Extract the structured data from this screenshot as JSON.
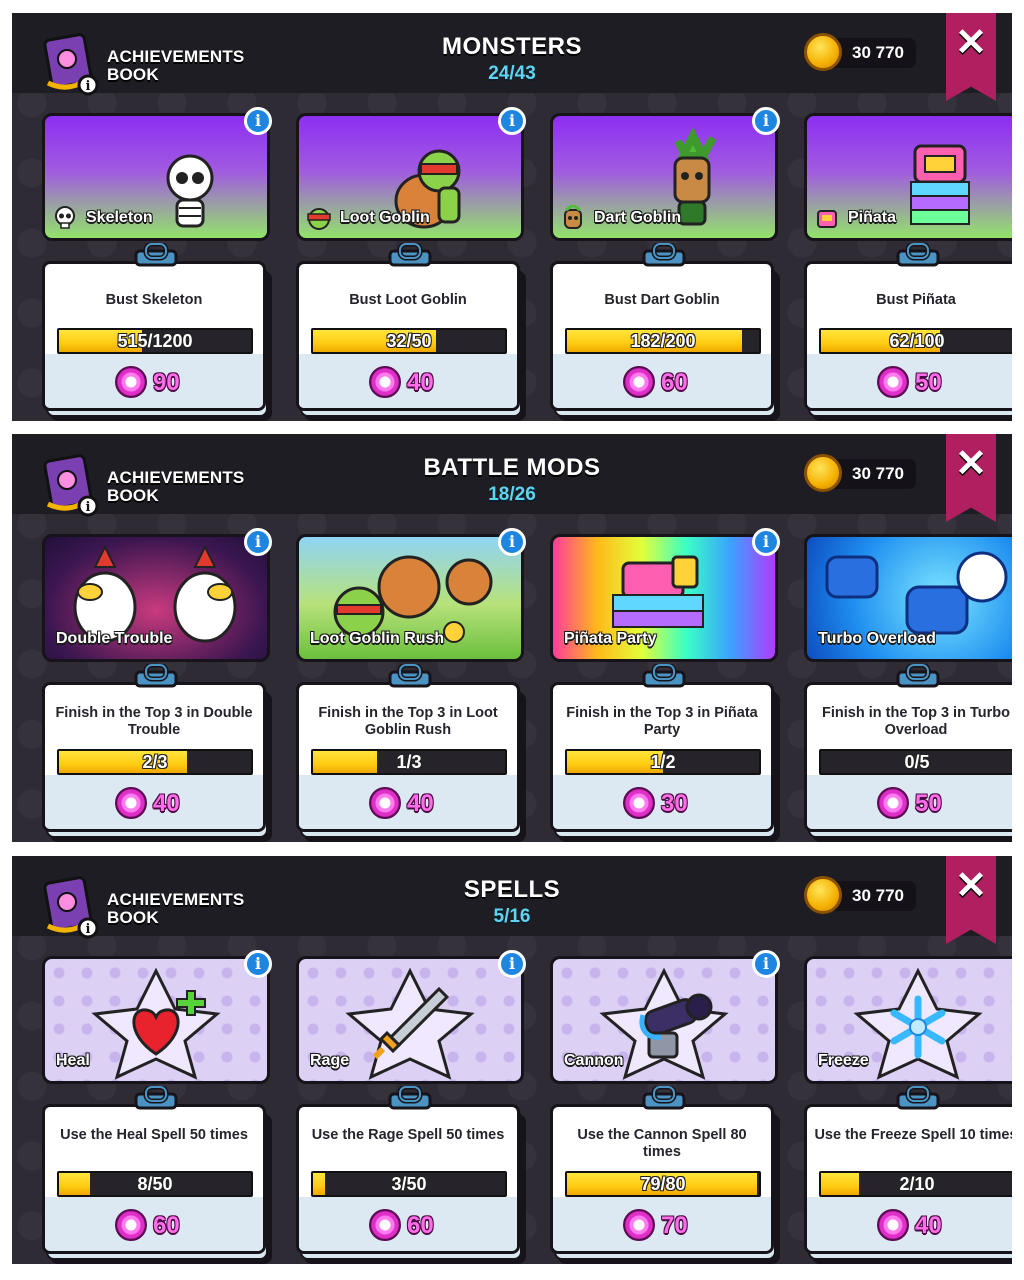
{
  "panels": [
    {
      "book_label_1": "ACHIEVEMENTS",
      "book_label_2": "BOOK",
      "title": "MONSTERS",
      "progress": "24/43",
      "coins": "30 770",
      "cards": [
        {
          "name": "Skeleton",
          "task": "Bust Skeleton",
          "progress_text": "515/1200",
          "fill": 0.43,
          "reward": "90"
        },
        {
          "name": "Loot Goblin",
          "task": "Bust Loot Goblin",
          "progress_text": "32/50",
          "fill": 0.64,
          "reward": "40"
        },
        {
          "name": "Dart Goblin",
          "task": "Bust Dart Goblin",
          "progress_text": "182/200",
          "fill": 0.91,
          "reward": "60"
        },
        {
          "name": "Piñata",
          "task": "Bust Piñata",
          "progress_text": "62/100",
          "fill": 0.62,
          "reward": "50"
        }
      ]
    },
    {
      "book_label_1": "ACHIEVEMENTS",
      "book_label_2": "BOOK",
      "title": "BATTLE MODS",
      "progress": "18/26",
      "coins": "30 770",
      "cards": [
        {
          "name": "Double Trouble",
          "task": "Finish in the Top 3 in Double Trouble",
          "progress_text": "2/3",
          "fill": 0.667,
          "reward": "40"
        },
        {
          "name": "Loot Goblin Rush",
          "task": "Finish in the Top 3 in Loot Goblin Rush",
          "progress_text": "1/3",
          "fill": 0.333,
          "reward": "40"
        },
        {
          "name": "Piñata Party",
          "task": "Finish in the Top 3 in Piñata Party",
          "progress_text": "1/2",
          "fill": 0.5,
          "reward": "30"
        },
        {
          "name": "Turbo Overload",
          "task": "Finish in the Top 3 in Turbo Overload",
          "progress_text": "0/5",
          "fill": 0.0,
          "reward": "50"
        }
      ]
    },
    {
      "book_label_1": "ACHIEVEMENTS",
      "book_label_2": "BOOK",
      "title": "SPELLS",
      "progress": "5/16",
      "coins": "30 770",
      "cards": [
        {
          "name": "Heal",
          "task": "Use the Heal Spell 50 times",
          "progress_text": "8/50",
          "fill": 0.16,
          "reward": "60"
        },
        {
          "name": "Rage",
          "task": "Use the Rage Spell 50 times",
          "progress_text": "3/50",
          "fill": 0.06,
          "reward": "60"
        },
        {
          "name": "Cannon",
          "task": "Use the Cannon Spell 80 times",
          "progress_text": "79/80",
          "fill": 0.987,
          "reward": "70"
        },
        {
          "name": "Freeze",
          "task": "Use the Freeze Spell 10 times",
          "progress_text": "2/10",
          "fill": 0.2,
          "reward": "40"
        }
      ]
    }
  ],
  "icons": {
    "info": "info-icon",
    "close": "close-x-icon",
    "coin": "gold-coin-icon",
    "gem": "gem-reward-icon",
    "book": "achievements-book-icon"
  },
  "colors": {
    "panel_bg": "#2e2b34",
    "header_bg": "#1f1d24",
    "accent_progress": "#5fd4f0",
    "bar_fill": "#ffcc12",
    "close_ribbon": "#b01f5f",
    "reward_text": "#ff6ee8"
  },
  "symbols": {
    "info": "i",
    "close": "✕"
  }
}
